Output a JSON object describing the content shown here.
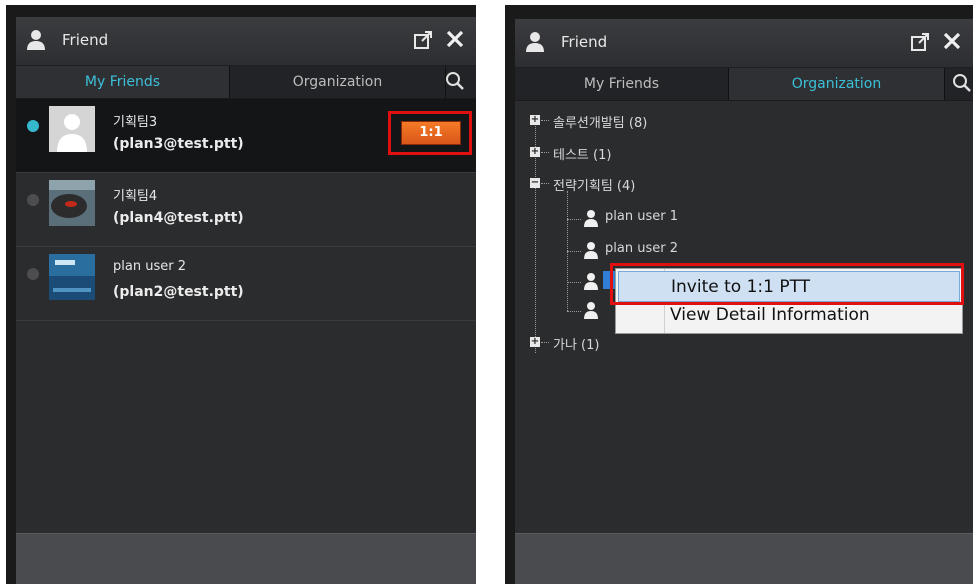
{
  "left_panel": {
    "title": "Friend",
    "tabs": [
      {
        "label": "My Friends",
        "active": true
      },
      {
        "label": "Organization",
        "active": false
      }
    ],
    "friends": [
      {
        "name": "기획팀3",
        "email": "(plan3@test.ptt)",
        "online": true,
        "selected": true,
        "action_label": "1:1"
      },
      {
        "name": "기획팀4",
        "email": "(plan4@test.ptt)",
        "online": false,
        "selected": false
      },
      {
        "name": "plan user 2",
        "email": "(plan2@test.ptt)",
        "online": false,
        "selected": false
      }
    ]
  },
  "right_panel": {
    "title": "Friend",
    "tabs": [
      {
        "label": "My Friends",
        "active": false
      },
      {
        "label": "Organization",
        "active": true
      }
    ],
    "tree": [
      {
        "label": "솔루션개발팀 (8)",
        "expanded": false
      },
      {
        "label": "테스트 (1)",
        "expanded": false
      },
      {
        "label": "전략기획팀 (4)",
        "expanded": true,
        "children": [
          "plan user 1",
          "plan user 2"
        ]
      },
      {
        "label": "가나 (1)",
        "expanded": false
      }
    ],
    "context_menu": [
      {
        "label": "Invite to 1:1 PTT",
        "highlighted": true
      },
      {
        "label": "View Detail Information",
        "highlighted": false
      }
    ]
  },
  "colors": {
    "accent": "#3cc0d8",
    "action_button": "#e8651f",
    "highlight_box": "#e01010",
    "panel_bg": "#2b2c2e"
  }
}
